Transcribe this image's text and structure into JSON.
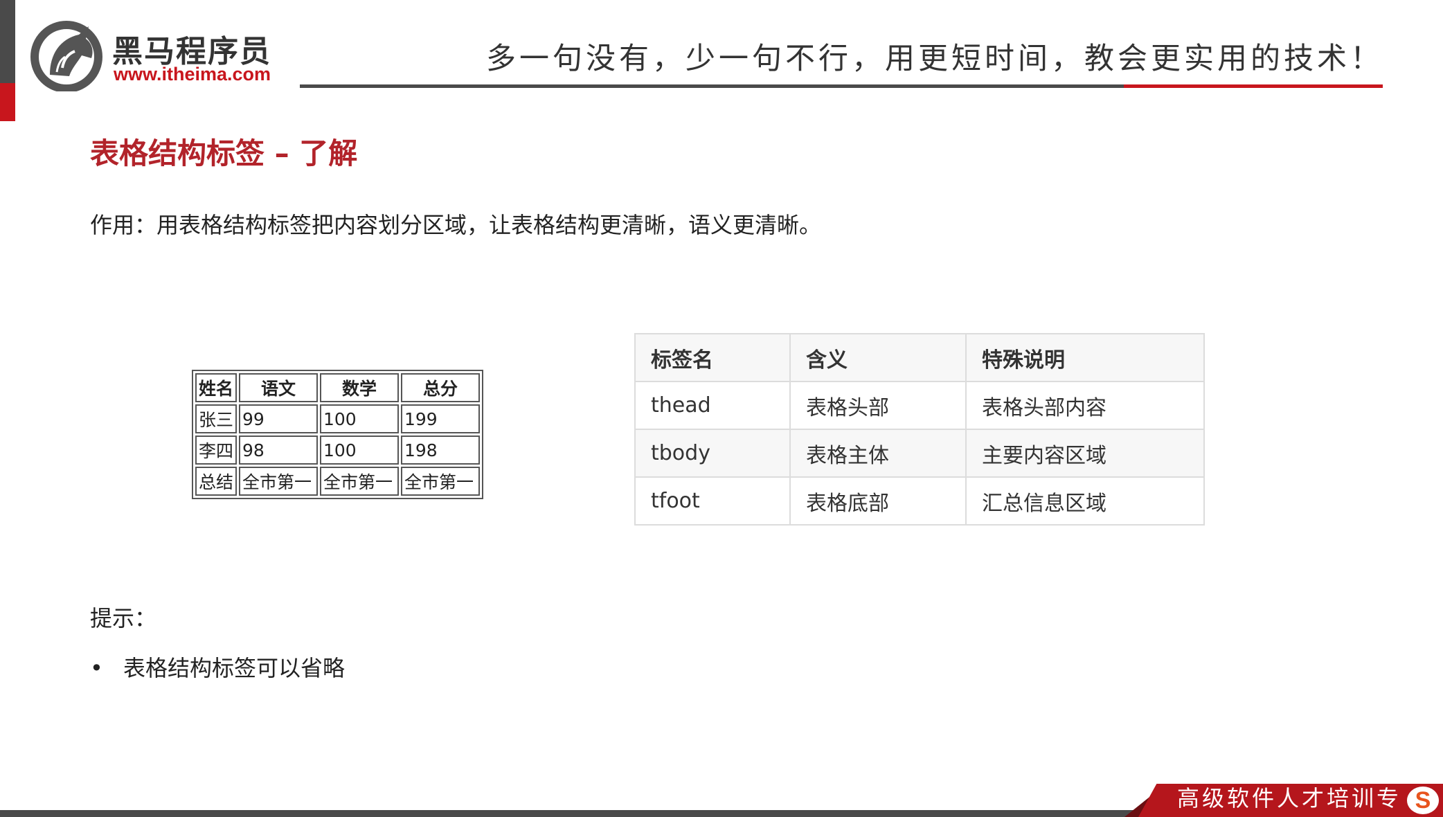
{
  "header": {
    "brand_name": "黑马程序员",
    "brand_url": "www.itheima.com",
    "slogan": "多一句没有，少一句不行，用更短时间，教会更实用的技术！"
  },
  "slide": {
    "title": "表格结构标签 – 了解",
    "purpose": "作用：用表格结构标签把内容划分区域，让表格结构更清晰，语义更清晰。"
  },
  "example_table": {
    "headers": [
      "姓名",
      "语文",
      "数学",
      "总分"
    ],
    "rows": [
      [
        "张三",
        "99",
        "100",
        "199"
      ],
      [
        "李四",
        "98",
        "100",
        "198"
      ],
      [
        "总结",
        "全市第一",
        "全市第一",
        "全市第一"
      ]
    ]
  },
  "reference_table": {
    "headers": [
      "标签名",
      "含义",
      "特殊说明"
    ],
    "rows": [
      [
        "thead",
        "表格头部",
        "表格头部内容"
      ],
      [
        "tbody",
        "表格主体",
        "主要内容区域"
      ],
      [
        "tfoot",
        "表格底部",
        "汇总信息区域"
      ]
    ]
  },
  "tips": {
    "label": "提示：",
    "bullet": "•",
    "items": [
      "表格结构标签可以省略"
    ]
  },
  "footer": {
    "tagline": "高级软件人才培训专",
    "icon": "S"
  },
  "colors": {
    "accent_red": "#c8161d",
    "title_red": "#b2232a",
    "dark_gray": "#4a4a4a"
  }
}
